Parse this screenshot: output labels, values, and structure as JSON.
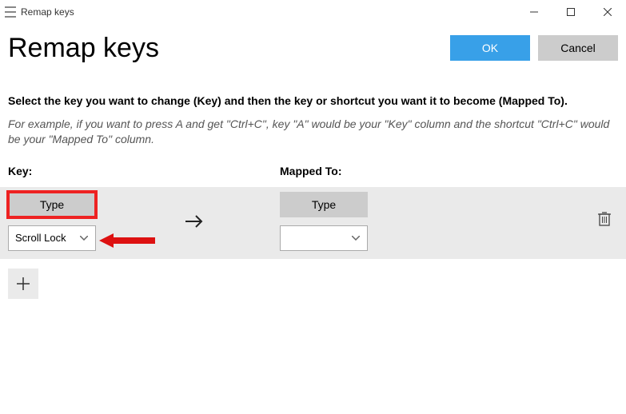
{
  "window": {
    "title": "Remap keys"
  },
  "header": {
    "page_title": "Remap keys",
    "ok_label": "OK",
    "cancel_label": "Cancel"
  },
  "text": {
    "instruction": "Select the key you want to change (Key) and then the key or shortcut you want it to become (Mapped To).",
    "example": "For example, if you want to press A and get \"Ctrl+C\", key \"A\" would be your \"Key\" column and the shortcut \"Ctrl+C\" would be your \"Mapped To\" column."
  },
  "columns": {
    "key_label": "Key:",
    "mapped_label": "Mapped To:"
  },
  "row": {
    "key": {
      "type_label": "Type",
      "selected": "Scroll Lock"
    },
    "mapped": {
      "type_label": "Type",
      "selected": ""
    }
  },
  "annotations": {
    "highlight_key_type": true,
    "arrow_to_key_dropdown": true
  }
}
